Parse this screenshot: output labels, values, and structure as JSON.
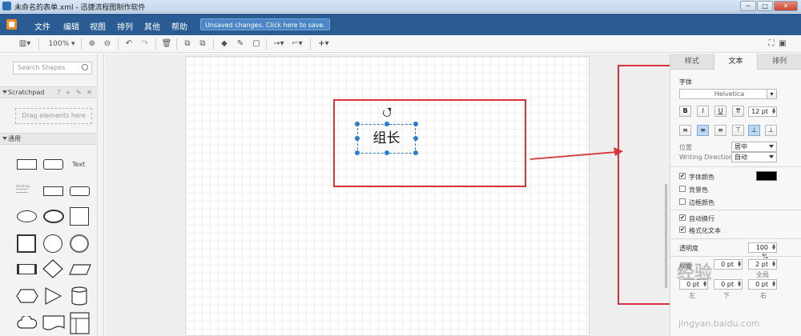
{
  "window": {
    "title": "未命名的表单.xml - 迅捷流程图制作软件",
    "min": "─",
    "max": "□",
    "close": "✕"
  },
  "menubar": {
    "items": [
      "文件",
      "编辑",
      "视图",
      "排列",
      "其他",
      "帮助"
    ],
    "save_notice": "Unsaved changes. Click here to save."
  },
  "toolbar": {
    "zoom": "100%",
    "zoom_in": "⊕",
    "zoom_out": "⊖",
    "undo": "↶",
    "redo": "↷",
    "delete": "🗑",
    "to_front": "⧉",
    "to_back": "⧉",
    "fill": "◆",
    "line_color": "✎",
    "shadow": "▢",
    "connection": "→",
    "waypoints": "⌐",
    "insert": "+",
    "fullscreen": "⛶",
    "format_panel": "▣"
  },
  "leftpanel": {
    "search_placeholder": "Search Shapes",
    "scratchpad_title": "Scratchpad",
    "scratchpad_icons": "? + ✎ ✕",
    "drop_hint": "Drag elements here",
    "general_title": "通用",
    "text_shape": "Text",
    "heading_shape": "Heading"
  },
  "canvas": {
    "selected_text": "组长"
  },
  "format_panel": {
    "tabs": [
      "样式",
      "文本",
      "排列"
    ],
    "active_tab": "文本",
    "font_label": "字体",
    "font_family": "Helvetica",
    "bold": "B",
    "italic": "I",
    "underline": "U",
    "vertical": "⇈",
    "font_size": "12 pt",
    "align_left": "≡",
    "align_center": "≡",
    "align_right": "≡",
    "valign_top": "⊤",
    "valign_middle": "⊥",
    "valign_bottom": "⊥",
    "position_label": "位置",
    "position_value": "居中",
    "writing_direction_label": "Writing Direction",
    "writing_direction_value": "自动",
    "font_color_label": "字体颜色",
    "font_color_checked": true,
    "font_color": "#000000",
    "bg_color_label": "背景色",
    "border_color_label": "边框颜色",
    "wrap_label": "自动换行",
    "formatted_label": "格式化文本",
    "opacity_label": "透明度",
    "opacity_value": "100 %",
    "spacing_label": "间距",
    "spacing_top": "0 pt",
    "spacing_global": "2 pt",
    "global_label": "全局",
    "spacing_left": "0 pt",
    "spacing_bottom": "0 pt",
    "spacing_right": "0 pt",
    "left_label": "左",
    "bottom_label": "下",
    "right_label": "右"
  },
  "watermark": {
    "text": "经验",
    "url": "jingyan.baidu.com"
  },
  "colors": {
    "menubar": "#2a5c93",
    "annotation_red": "#d9333a",
    "selection_blue": "#2b7bd3"
  }
}
